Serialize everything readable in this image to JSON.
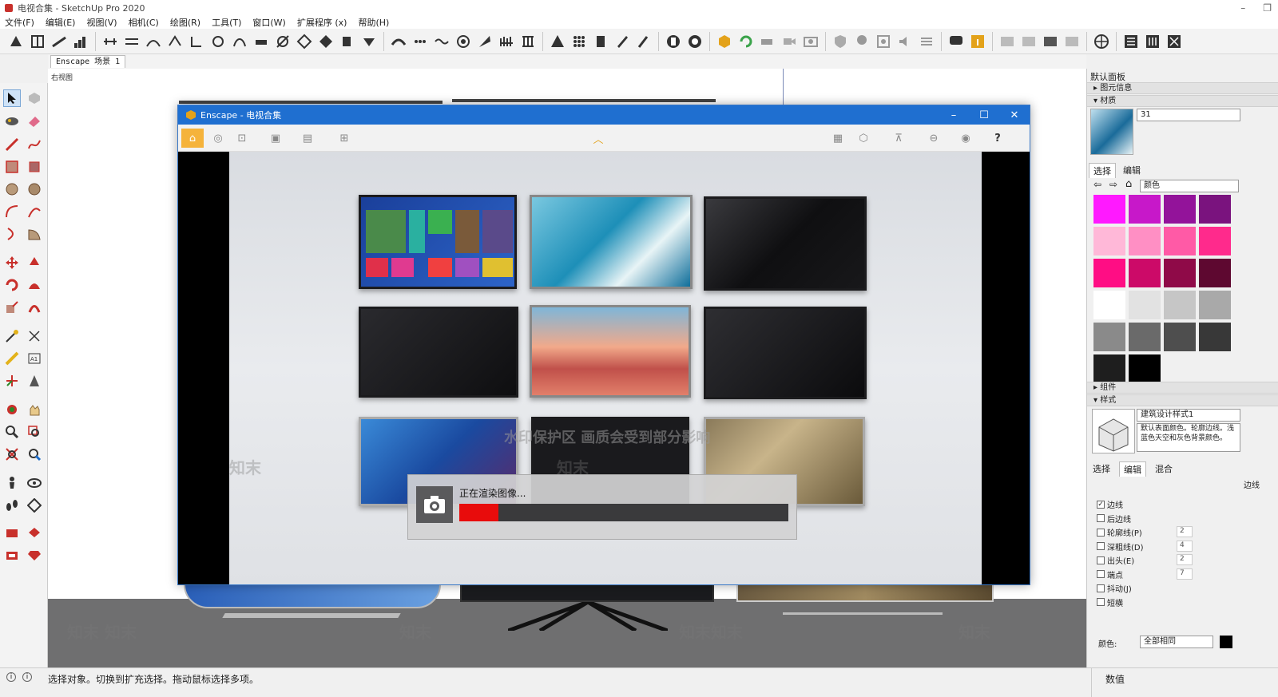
{
  "window": {
    "title": "电视合集 - SketchUp Pro 2020"
  },
  "menu": [
    "文件(F)",
    "编辑(E)",
    "视图(V)",
    "相机(C)",
    "绘图(R)",
    "工具(T)",
    "窗口(W)",
    "扩展程序 (x)",
    "帮助(H)"
  ],
  "scene_tab": "Enscape 场景 1",
  "view_label": "右视图",
  "enscape": {
    "title": "Enscape - 电视合集",
    "progress_label": "正在渲染图像...",
    "progress": 0.12,
    "watermark": "水印保护区    画质会受到部分影响"
  },
  "right_panel": {
    "default_tray": "默认面板",
    "entity_info": "图元信息",
    "materials": "材质",
    "material_name": "31",
    "tab_select": "选择",
    "tab_edit": "编辑",
    "library": "颜色",
    "components": "组件",
    "styles": "样式",
    "style_name": "建筑设计样式1",
    "style_desc": "默认表面颜色。轮廓边线。浅蓝色天空和灰色背景颜色。",
    "style_tab_mix": "混合",
    "edge_label": "边线",
    "checks": [
      {
        "label": "边线",
        "checked": true
      },
      {
        "label": "后边线",
        "checked": false
      },
      {
        "label": "轮廓线(P)",
        "checked": false,
        "value": "2"
      },
      {
        "label": "深粗线(D)",
        "checked": false,
        "value": "4"
      },
      {
        "label": "出头(E)",
        "checked": false,
        "value": "2"
      },
      {
        "label": "端点",
        "checked": false,
        "value": "7"
      },
      {
        "label": "抖动(J)",
        "checked": false
      },
      {
        "label": "短横",
        "checked": false
      }
    ],
    "color_label": "颜色:",
    "color_value": "全部相同",
    "colors": {
      "row1": [
        "#ff19ff",
        "#c718c9",
        "#93139a",
        "#7a137e"
      ],
      "row2": [
        "#ffb8d8",
        "#ff8fc4",
        "#ff5aa6",
        "#ff2a8c"
      ],
      "row3": [
        "#ff0d84",
        "#cc0a68",
        "#8f0a48",
        "#5e0830"
      ],
      "row4": [
        "#ffffff",
        "#e2e2e2",
        "#c6c6c6",
        "#a9a9a9"
      ],
      "row5": [
        "#8a8a8a",
        "#6a6a6a",
        "#4e4e4e",
        "#383838"
      ],
      "row6": [
        "#1e1e1e",
        "#000000"
      ]
    }
  },
  "status": {
    "message": "选择对象。切换到扩充选择。拖动鼠标选择多项。",
    "measure_label": "数值"
  }
}
